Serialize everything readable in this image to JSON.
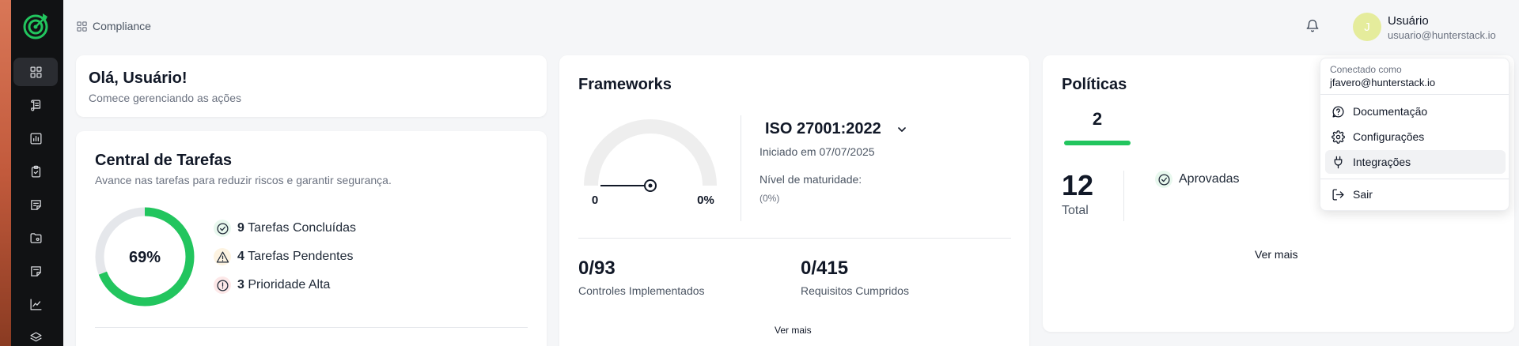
{
  "breadcrumb": {
    "label": "Compliance"
  },
  "user": {
    "initial": "J",
    "name": "Usuário",
    "email": "usuario@hunterstack.io"
  },
  "greeting": {
    "title": "Olá, Usuário!",
    "subtitle": "Comece gerenciando as ações"
  },
  "tasks": {
    "title": "Central de Tarefas",
    "subtitle": "Avance nas tarefas para reduzir riscos e garantir segurança.",
    "progress_label": "69%",
    "progress_value": 0.69,
    "colors": {
      "done": "#22c55e",
      "track": "#e5e7eb"
    },
    "items": [
      {
        "count": "9",
        "label": "Tarefas Concluídas",
        "icon": "check-circle-icon"
      },
      {
        "count": "4",
        "label": "Tarefas Pendentes",
        "icon": "warning-triangle-icon"
      },
      {
        "count": "3",
        "label": "Prioridade Alta",
        "icon": "alert-circle-icon"
      }
    ]
  },
  "frameworks": {
    "title": "Frameworks",
    "gauge_min": "0",
    "gauge_value_label": "0%",
    "selected": "ISO 27001:2022",
    "started": "Iniciado em 07/07/2025",
    "maturity_label": "Nível de maturidade:",
    "maturity_value": "(0%)",
    "controls_value": "0/93",
    "controls_label": "Controles Implementados",
    "requirements_value": "0/415",
    "requirements_label": "Requisitos Cumpridos",
    "more": "Ver mais"
  },
  "policies": {
    "title": "Políticas",
    "tab_count": "2",
    "accent": "#22c55e",
    "total_value": "12",
    "total_label": "Total",
    "approved_label": "Aprovadas",
    "more": "Ver mais"
  },
  "user_menu": {
    "connected_as_label": "Conectado como",
    "connected_email": "jfavero@hunterstack.io",
    "items": [
      {
        "label": "Documentação",
        "icon": "help-bubble-icon"
      },
      {
        "label": "Configurações",
        "icon": "gear-icon"
      },
      {
        "label": "Integrações",
        "icon": "plug-icon"
      },
      {
        "label": "Sair",
        "icon": "logout-icon"
      }
    ]
  }
}
